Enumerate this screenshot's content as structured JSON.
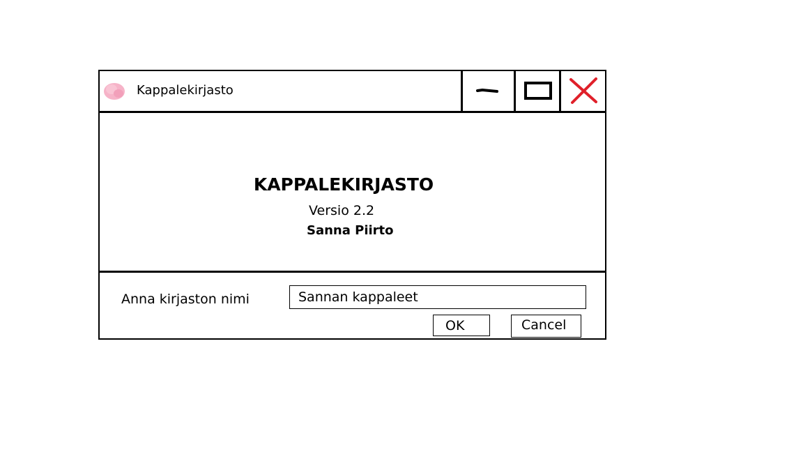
{
  "window": {
    "title": "Kappalekirjasto",
    "controls": {
      "minimize_icon": "minimize-icon",
      "maximize_icon": "maximize-icon",
      "close_icon": "close-icon",
      "close_color": "#e0202a"
    },
    "app_icon_color": "#f4a8c0"
  },
  "about": {
    "app_name": "KAPPALEKIRJASTO",
    "version": "Versio 2.2",
    "author": "Sanna Piirto"
  },
  "form": {
    "label": "Anna kirjaston nimi",
    "input_value": "Sannan kappaleet",
    "ok_label": "OK",
    "cancel_label": "Cancel"
  }
}
